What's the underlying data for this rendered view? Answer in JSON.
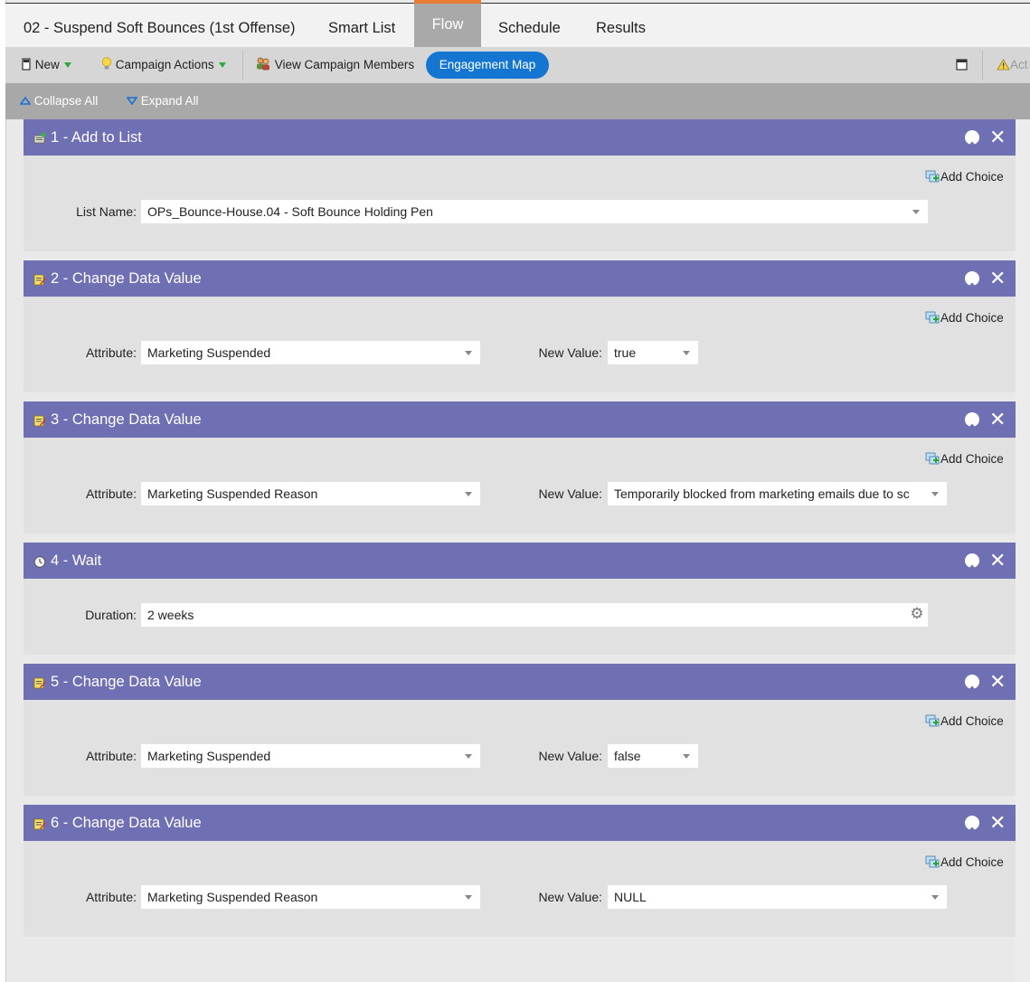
{
  "tabs": [
    {
      "label": "02 - Suspend Soft Bounces (1st Offense)"
    },
    {
      "label": "Smart List"
    },
    {
      "label": "Flow"
    },
    {
      "label": "Schedule"
    },
    {
      "label": "Results"
    }
  ],
  "toolbar": {
    "new_label": "New",
    "campaign_actions_label": "Campaign Actions",
    "view_members_label": "View Campaign Members",
    "engagement_map_label": "Engagement Map",
    "activate_label": "Act"
  },
  "subbar": {
    "collapse_label": "Collapse All",
    "expand_label": "Expand All"
  },
  "add_choice_label": "Add Choice",
  "steps": [
    {
      "title": "1 - Add to List",
      "icon": "add-list-icon",
      "fields": [
        {
          "label": "List Name:",
          "value": "OPs_Bounce-House.04 - Soft Bounce Holding Pen"
        }
      ]
    },
    {
      "title": "2 - Change Data Value",
      "icon": "change-data-icon",
      "fields": [
        {
          "label": "Attribute:",
          "value": "Marketing Suspended"
        },
        {
          "label": "New Value:",
          "value": "true"
        }
      ]
    },
    {
      "title": "3 - Change Data Value",
      "icon": "change-data-icon",
      "fields": [
        {
          "label": "Attribute:",
          "value": "Marketing Suspended Reason"
        },
        {
          "label": "New Value:",
          "value": "Temporarily blocked from marketing emails due to sc"
        }
      ]
    },
    {
      "title": "4 - Wait",
      "icon": "clock-icon",
      "fields": [
        {
          "label": "Duration:",
          "value": "2 weeks"
        }
      ]
    },
    {
      "title": "5 - Change Data Value",
      "icon": "change-data-icon",
      "fields": [
        {
          "label": "Attribute:",
          "value": "Marketing Suspended"
        },
        {
          "label": "New Value:",
          "value": "false"
        }
      ]
    },
    {
      "title": "6 - Change Data Value",
      "icon": "change-data-icon",
      "fields": [
        {
          "label": "Attribute:",
          "value": "Marketing Suspended Reason"
        },
        {
          "label": "New Value:",
          "value": "NULL"
        }
      ]
    }
  ],
  "colors": {
    "step_header": "#6f6fb3",
    "active_tab_accent": "#e87b2f",
    "engagement_button": "#1576d1"
  }
}
